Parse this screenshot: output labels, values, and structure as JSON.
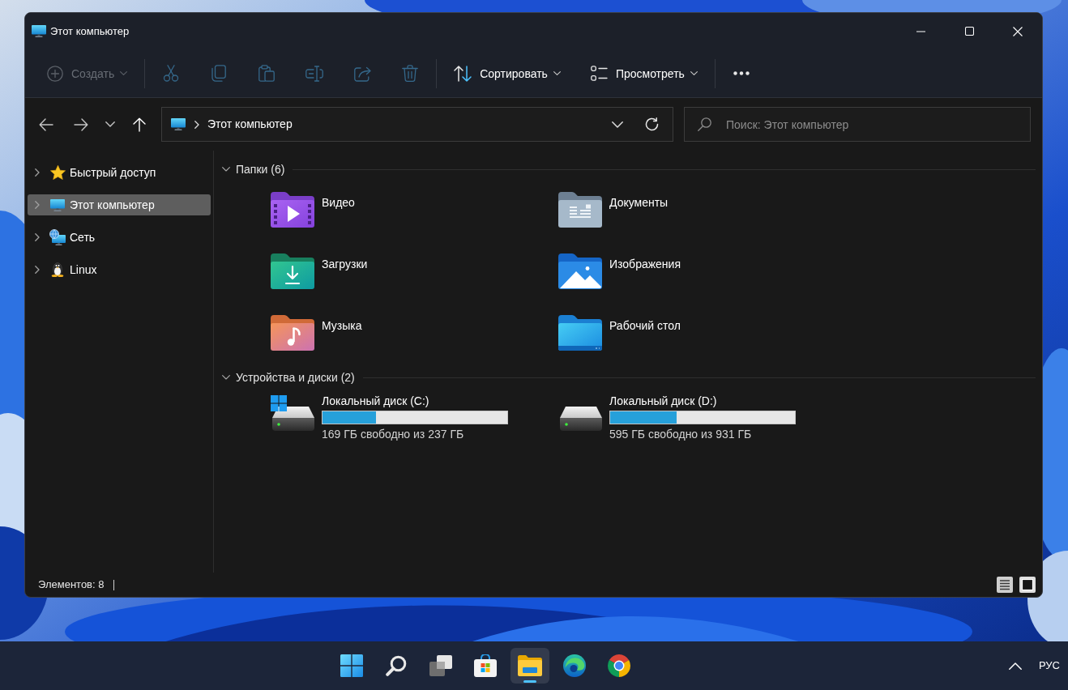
{
  "window": {
    "title": "Этот компьютер"
  },
  "toolbar": {
    "groups": [
      [
        {
          "kind": "new",
          "label": "Создать",
          "disabled": true
        }
      ],
      [
        {
          "kind": "cut",
          "disabled": true
        },
        {
          "kind": "copy",
          "disabled": true
        },
        {
          "kind": "paste",
          "disabled": true
        },
        {
          "kind": "rename",
          "disabled": true
        },
        {
          "kind": "share",
          "disabled": true
        },
        {
          "kind": "delete",
          "disabled": true
        }
      ],
      [
        {
          "kind": "sort",
          "label": "Сортировать",
          "disabled": false
        },
        {
          "kind": "view",
          "label": "Просмотреть",
          "disabled": false
        }
      ],
      [
        {
          "kind": "more",
          "disabled": false
        }
      ]
    ]
  },
  "address_bar": {
    "path": [
      "Этот компьютер"
    ]
  },
  "search": {
    "placeholder": "Поиск: Этот компьютер"
  },
  "sidebar": {
    "items": [
      {
        "kind": "quick-access",
        "label": "Быстрый доступ",
        "expanded": false,
        "selected": false
      },
      {
        "kind": "computer",
        "label": "Этот компьютер",
        "expanded": false,
        "selected": true
      },
      {
        "kind": "network",
        "label": "Сеть",
        "expanded": false,
        "selected": false
      },
      {
        "kind": "linux",
        "label": "Linux",
        "expanded": false,
        "selected": false
      }
    ]
  },
  "content": {
    "groups": [
      {
        "title": "Папки (6)",
        "expanded": true,
        "items": [
          {
            "kind": "videos",
            "label": "Видео"
          },
          {
            "kind": "documents",
            "label": "Документы"
          },
          {
            "kind": "downloads",
            "label": "Загрузки"
          },
          {
            "kind": "pictures",
            "label": "Изображения"
          },
          {
            "kind": "music",
            "label": "Музыка"
          },
          {
            "kind": "desktop",
            "label": "Рабочий стол"
          }
        ]
      },
      {
        "title": "Устройства и диски (2)",
        "expanded": true,
        "items": [
          {
            "kind": "system-drive",
            "label": "Локальный диск (C:)",
            "level": 0.29,
            "reading": "169 ГБ свободно из 237 ГБ"
          },
          {
            "kind": "drive",
            "label": "Локальный диск (D:)",
            "level": 0.36,
            "reading": "595 ГБ свободно из 931 ГБ"
          }
        ]
      }
    ]
  },
  "status_bar": {
    "item_count": "Элементов: 8"
  },
  "taskbar": {
    "apps": [
      {
        "kind": "start",
        "active": false
      },
      {
        "kind": "search",
        "active": false
      },
      {
        "kind": "task-view",
        "active": false
      },
      {
        "kind": "store",
        "active": false
      },
      {
        "kind": "explorer",
        "active": true
      },
      {
        "kind": "edge",
        "active": false
      },
      {
        "kind": "chrome",
        "active": false
      }
    ],
    "language": "РУС"
  }
}
